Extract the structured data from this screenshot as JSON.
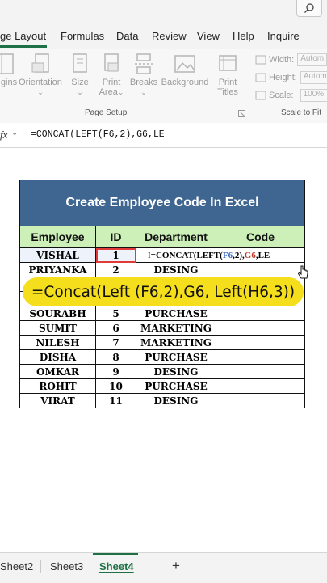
{
  "ribbon_tabs": [
    "ge Layout",
    "Formulas",
    "Data",
    "Review",
    "View",
    "Help",
    "Inquire"
  ],
  "ribbon_buttons": {
    "margins": "gins",
    "orientation": "Orientation",
    "size": "Size",
    "print_area": "Print\nArea",
    "breaks": "Breaks",
    "background": "Background",
    "print_titles": "Print\nTitles"
  },
  "page_setup_label": "Page Setup",
  "scale_to_fit": {
    "label": "Scale to Fit",
    "width_label": "Width:",
    "width_value": "Autom",
    "height_label": "Height:",
    "height_value": "Autom",
    "scale_label": "Scale:",
    "scale_value": "100%"
  },
  "formula_bar": {
    "fx_label": "fx",
    "content": "=CONCAT(LEFT(F6,2),G6,LE"
  },
  "table": {
    "title": "Create Employee Code In Excel",
    "headers": [
      "Employee",
      "ID",
      "Department",
      "Code"
    ],
    "rows": [
      {
        "employee": "VISHAL",
        "id": "1",
        "department": "",
        "code": ""
      },
      {
        "employee": "PRIYANKA",
        "id": "2",
        "department": "DESING",
        "code": ""
      },
      {
        "employee": "",
        "id": "",
        "department": "",
        "code": ""
      },
      {
        "employee": "",
        "id": "",
        "department": "",
        "code": ""
      },
      {
        "employee": "SOURABH",
        "id": "5",
        "department": "PURCHASE",
        "code": ""
      },
      {
        "employee": "SUMIT",
        "id": "6",
        "department": "MARKETING",
        "code": ""
      },
      {
        "employee": "NILESH",
        "id": "7",
        "department": "MARKETING",
        "code": ""
      },
      {
        "employee": "DISHA",
        "id": "8",
        "department": "PURCHASE",
        "code": ""
      },
      {
        "employee": "OMKAR",
        "id": "9",
        "department": "DESING",
        "code": ""
      },
      {
        "employee": "ROHIT",
        "id": "10",
        "department": "PURCHASE",
        "code": ""
      },
      {
        "employee": "VIRAT",
        "id": "11",
        "department": "DESING",
        "code": ""
      }
    ],
    "editing_formula": {
      "prefix": "=CONCAT(LEFT(",
      "ref1": "F6",
      "mid": ",2),",
      "ref2": "G6",
      "suffix": ",LE"
    }
  },
  "overlay_text": "=Concat(Left (F6,2),G6, Left(H6,3))",
  "sheet_tabs": [
    "Sheet2",
    "Sheet3",
    "Sheet4"
  ],
  "active_sheet": "Sheet4",
  "add_sheet": "+",
  "colors": {
    "title_bg": "#3f6690",
    "header_bg": "#cdf0b8",
    "overlay_bg": "#f5df1c",
    "accent": "#1e7145"
  }
}
